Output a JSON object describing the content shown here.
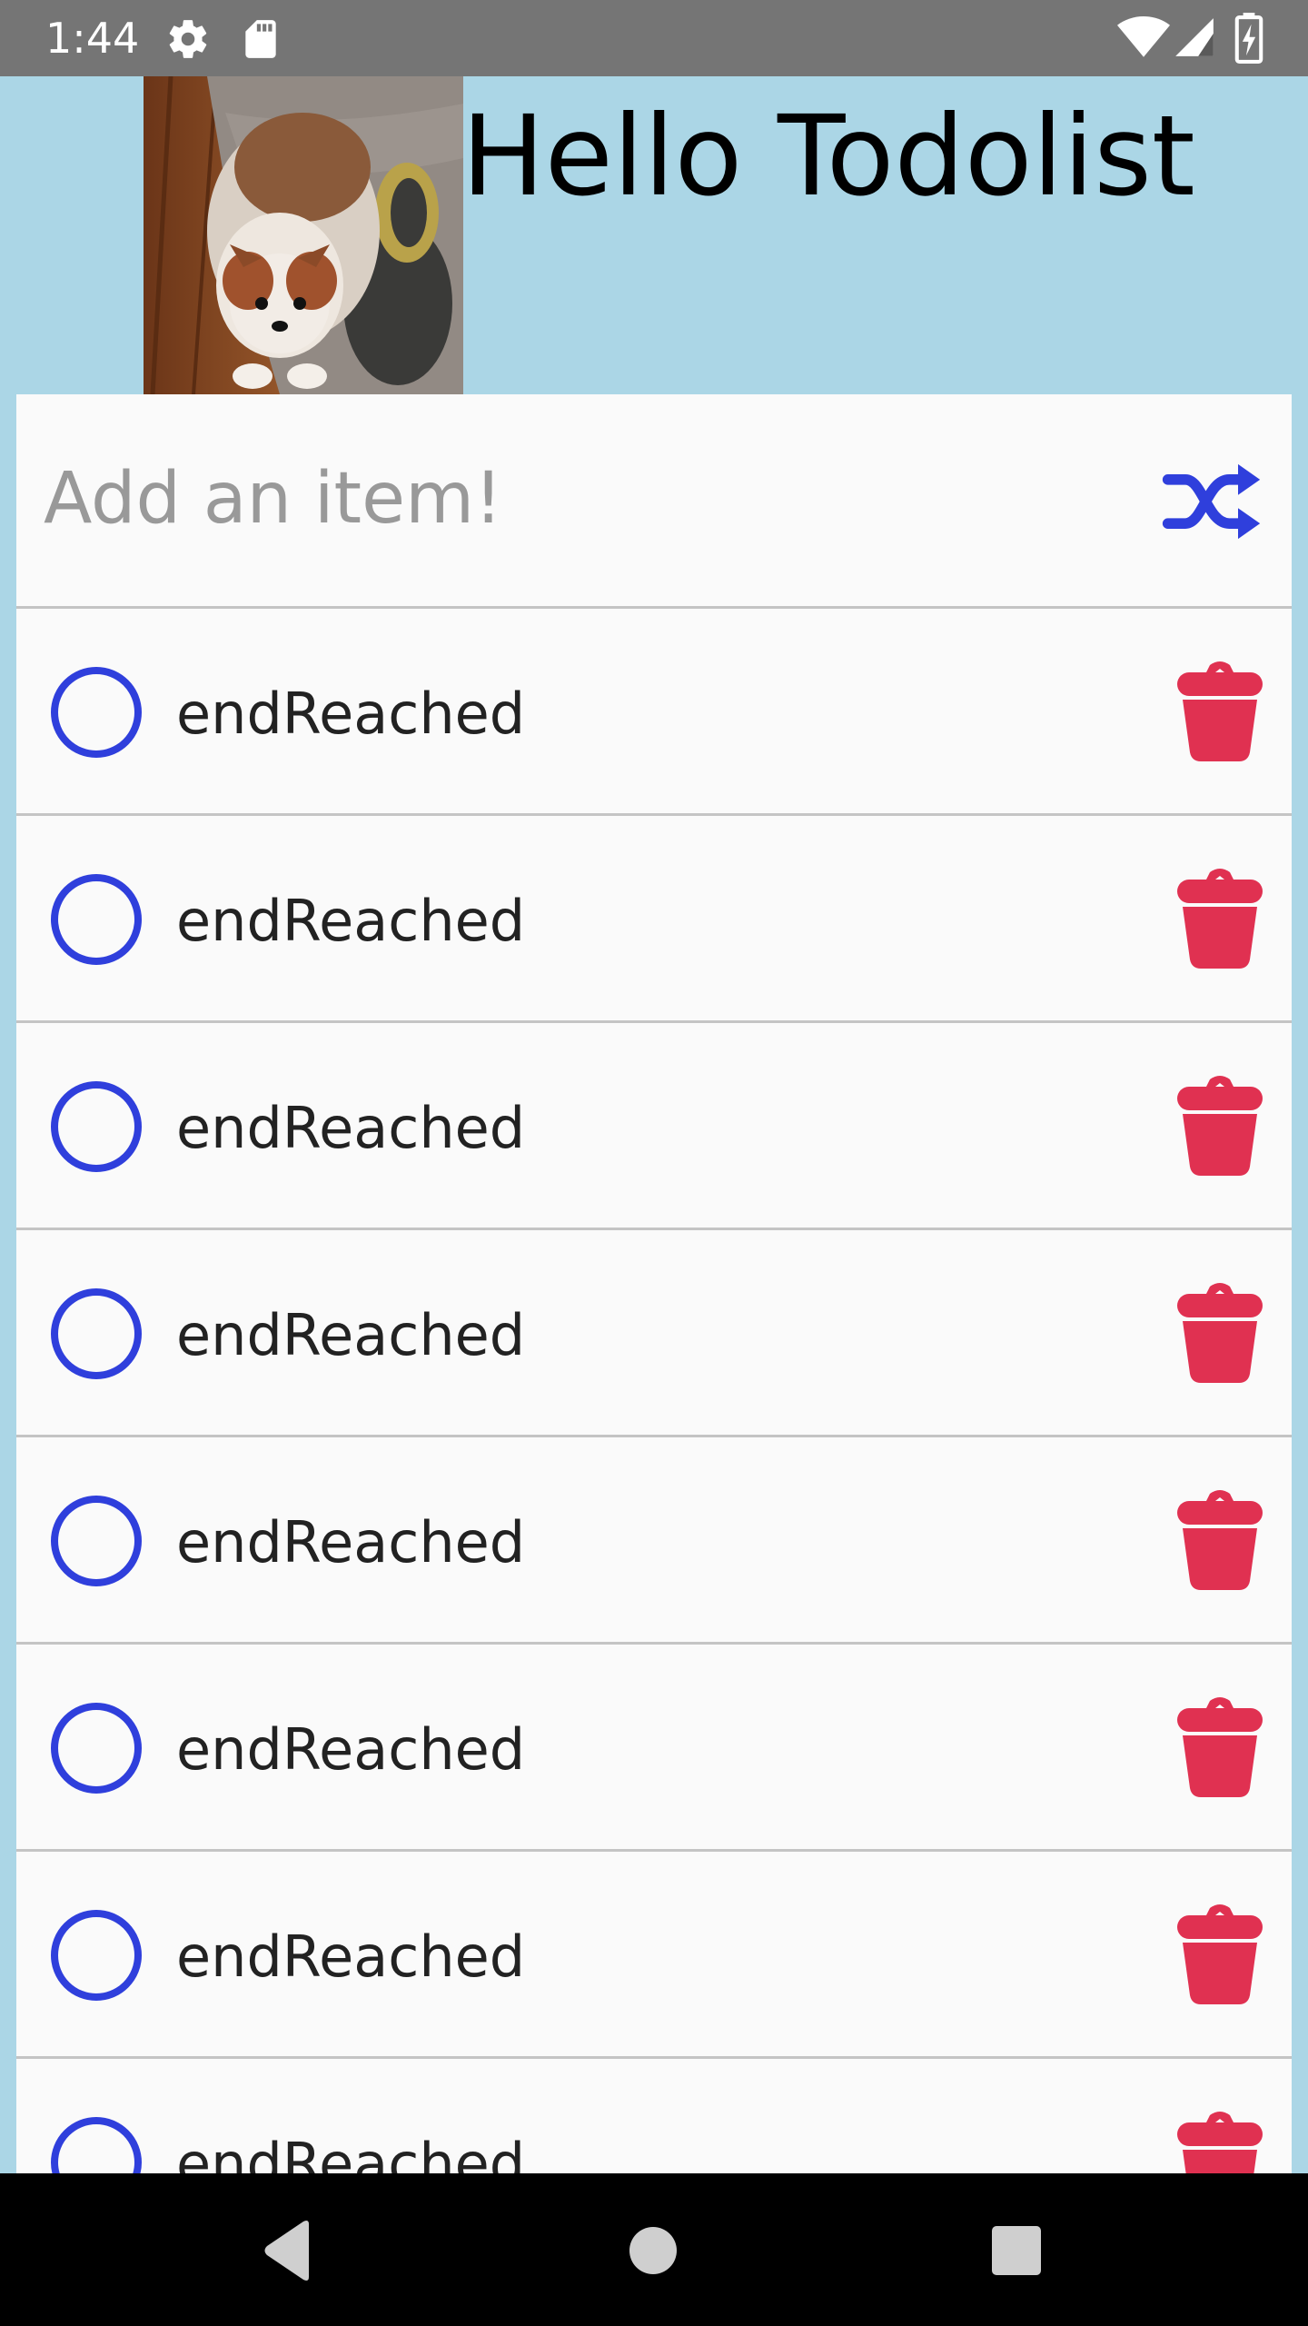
{
  "status_bar": {
    "time": "1:44",
    "icons": [
      "settings-gear-icon",
      "sd-card-icon",
      "wifi-icon",
      "cell-signal-icon",
      "battery-charging-icon"
    ]
  },
  "header": {
    "title": "Hello Todolist",
    "avatar": "pomeranian-dog-photo"
  },
  "add_item": {
    "placeholder": "Add an item!",
    "value": "",
    "shuffle_icon": "shuffle-icon"
  },
  "todos": [
    {
      "text": "endReached",
      "done": false
    },
    {
      "text": "endReached",
      "done": false
    },
    {
      "text": "endReached",
      "done": false
    },
    {
      "text": "endReached",
      "done": false
    },
    {
      "text": "endReached",
      "done": false
    },
    {
      "text": "endReached",
      "done": false
    },
    {
      "text": "endReached",
      "done": false
    },
    {
      "text": "endReached",
      "done": false
    }
  ],
  "nav": {
    "buttons": [
      "back-triangle-icon",
      "home-circle-icon",
      "recents-square-icon"
    ]
  },
  "colors": {
    "background": "#abd6e6",
    "accent_blue": "#2f3fdc",
    "delete_red": "#e03151",
    "row_background": "#fafafa"
  }
}
